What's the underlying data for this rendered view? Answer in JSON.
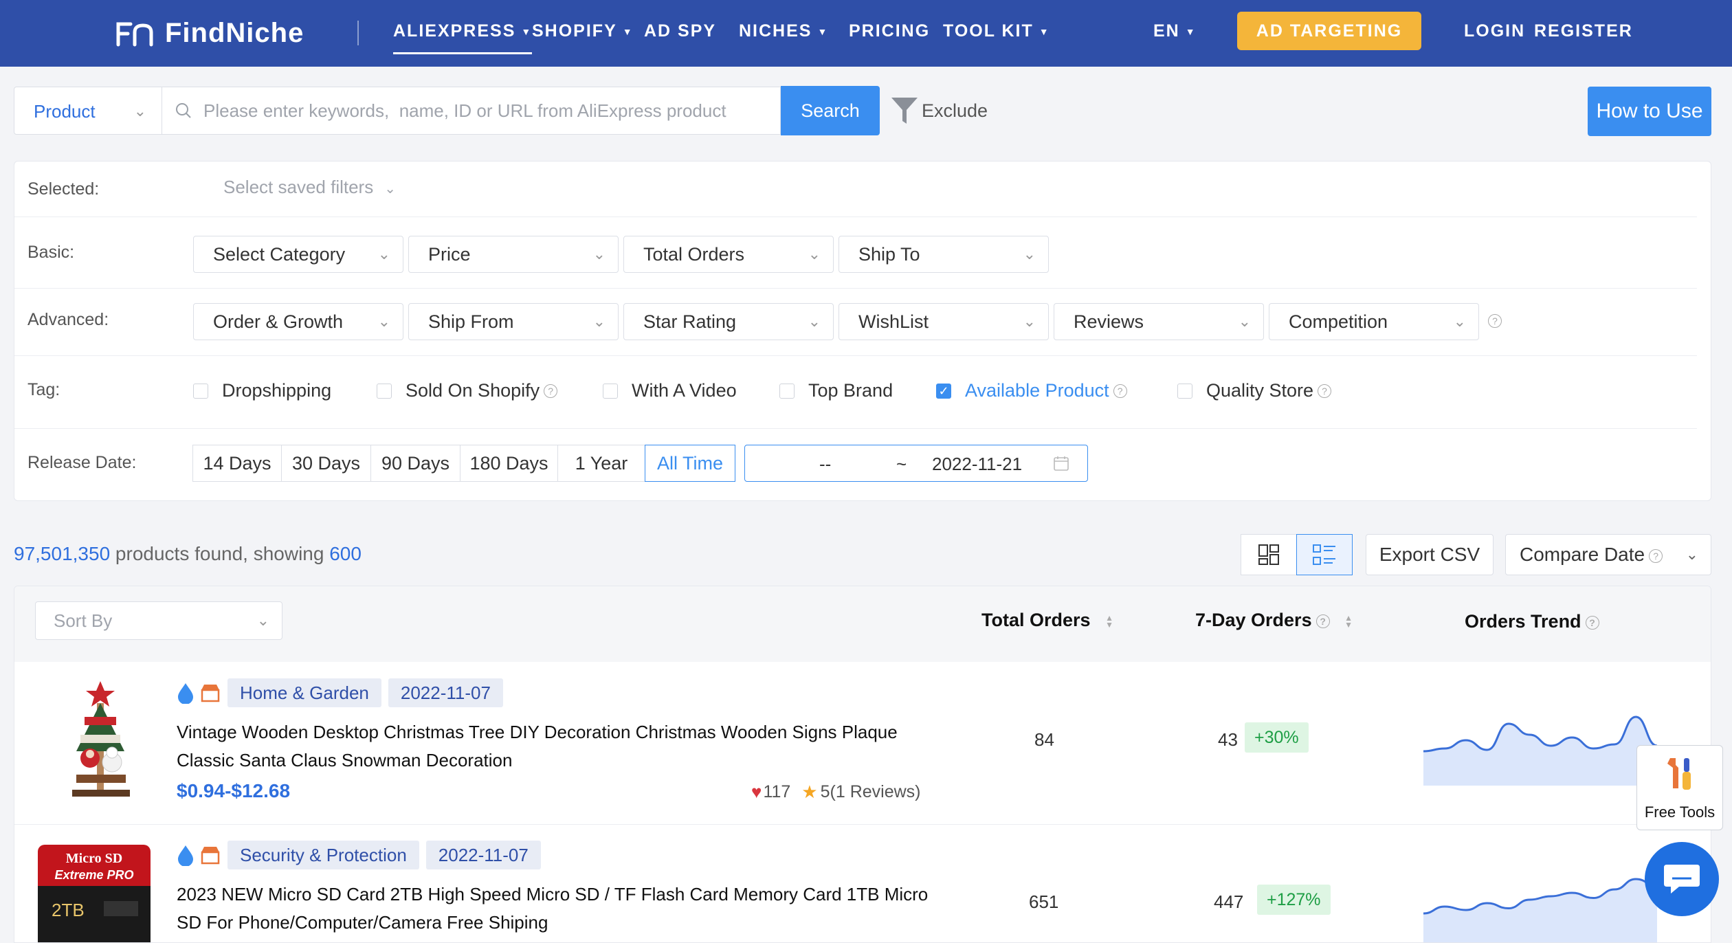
{
  "nav": {
    "logo_text": "FindNiche",
    "items": [
      {
        "label": "ALIEXPRESS",
        "has_caret": true
      },
      {
        "label": "SHOPIFY",
        "has_caret": true
      },
      {
        "label": "AD SPY",
        "has_caret": false
      },
      {
        "label": "NICHES",
        "has_caret": true
      },
      {
        "label": "PRICING",
        "has_caret": false
      },
      {
        "label": "TOOL KIT",
        "has_caret": true
      }
    ],
    "lang": "EN",
    "ad_targeting": "AD TARGETING",
    "login": "LOGIN",
    "register": "REGISTER"
  },
  "search": {
    "type_selected": "Product",
    "placeholder": "Please enter keywords,  name, ID or URL from AliExpress product",
    "button": "Search",
    "exclude": "Exclude",
    "how_to_use": "How to Use"
  },
  "filters": {
    "selected_label": "Selected:",
    "saved_filters_placeholder": "Select saved filters",
    "basic_label": "Basic:",
    "basic": [
      "Select Category",
      "Price",
      "Total Orders",
      "Ship To"
    ],
    "advanced_label": "Advanced:",
    "advanced": [
      "Order & Growth",
      "Ship From",
      "Star Rating",
      "WishList",
      "Reviews",
      "Competition"
    ],
    "tag_label": "Tag:",
    "tags": [
      {
        "label": "Dropshipping",
        "checked": false,
        "help": false
      },
      {
        "label": "Sold On Shopify",
        "checked": false,
        "help": true
      },
      {
        "label": "With A Video",
        "checked": false,
        "help": false
      },
      {
        "label": "Top Brand",
        "checked": false,
        "help": false
      },
      {
        "label": "Available Product",
        "checked": true,
        "help": true
      },
      {
        "label": "Quality Store",
        "checked": false,
        "help": true
      }
    ],
    "release_label": "Release Date:",
    "release_options": [
      "14 Days",
      "30 Days",
      "90 Days",
      "180 Days",
      "1 Year",
      "All Time"
    ],
    "release_active": "All Time",
    "date_from": "--",
    "date_sep": "~",
    "date_to": "2022-11-21"
  },
  "results": {
    "count": "97,501,350",
    "found_text": "products found, showing",
    "showing": "600",
    "export": "Export CSV",
    "compare": "Compare Date"
  },
  "table": {
    "sort_placeholder": "Sort By",
    "col_total_orders": "Total Orders",
    "col_7day": "7-Day Orders",
    "col_trend": "Orders Trend",
    "rows": [
      {
        "category": "Home & Garden",
        "date": "2022-11-07",
        "title": "Vintage Wooden Desktop Christmas Tree DIY Decoration Christmas Wooden Signs Plaque Classic Santa Claus Snowman Decoration",
        "price": "$0.94-$12.68",
        "wishlist": "117",
        "rating": "5(1 Reviews)",
        "total_orders": "84",
        "orders_7d": "43",
        "growth": "+30%",
        "trend": [
          10,
          12,
          18,
          11,
          30,
          22,
          14,
          20,
          12,
          15,
          35,
          14
        ]
      },
      {
        "category": "Security & Protection",
        "date": "2022-11-07",
        "title": "2023 NEW Micro SD Card 2TB High Speed Micro SD / TF Flash Card Memory Card 1TB Micro SD For Phone/Computer/Camera Free Shiping",
        "price": "",
        "wishlist": "",
        "rating": "",
        "total_orders": "651",
        "orders_7d": "447",
        "growth": "+127%",
        "trend": [
          8,
          12,
          10,
          14,
          11,
          16,
          18,
          20,
          17,
          22,
          28,
          24
        ],
        "card_text": {
          "line1": "Micro SD",
          "line2": "Extreme PRO",
          "capacity": "2TB"
        }
      }
    ]
  },
  "floating": {
    "free_tools": "Free Tools"
  },
  "colors": {
    "nav_bg": "#2f4fa8",
    "accent": "#3a8ef0",
    "ad_btn": "#f4b53a",
    "growth_bg": "#def5e3",
    "growth_text": "#1e9e45"
  }
}
